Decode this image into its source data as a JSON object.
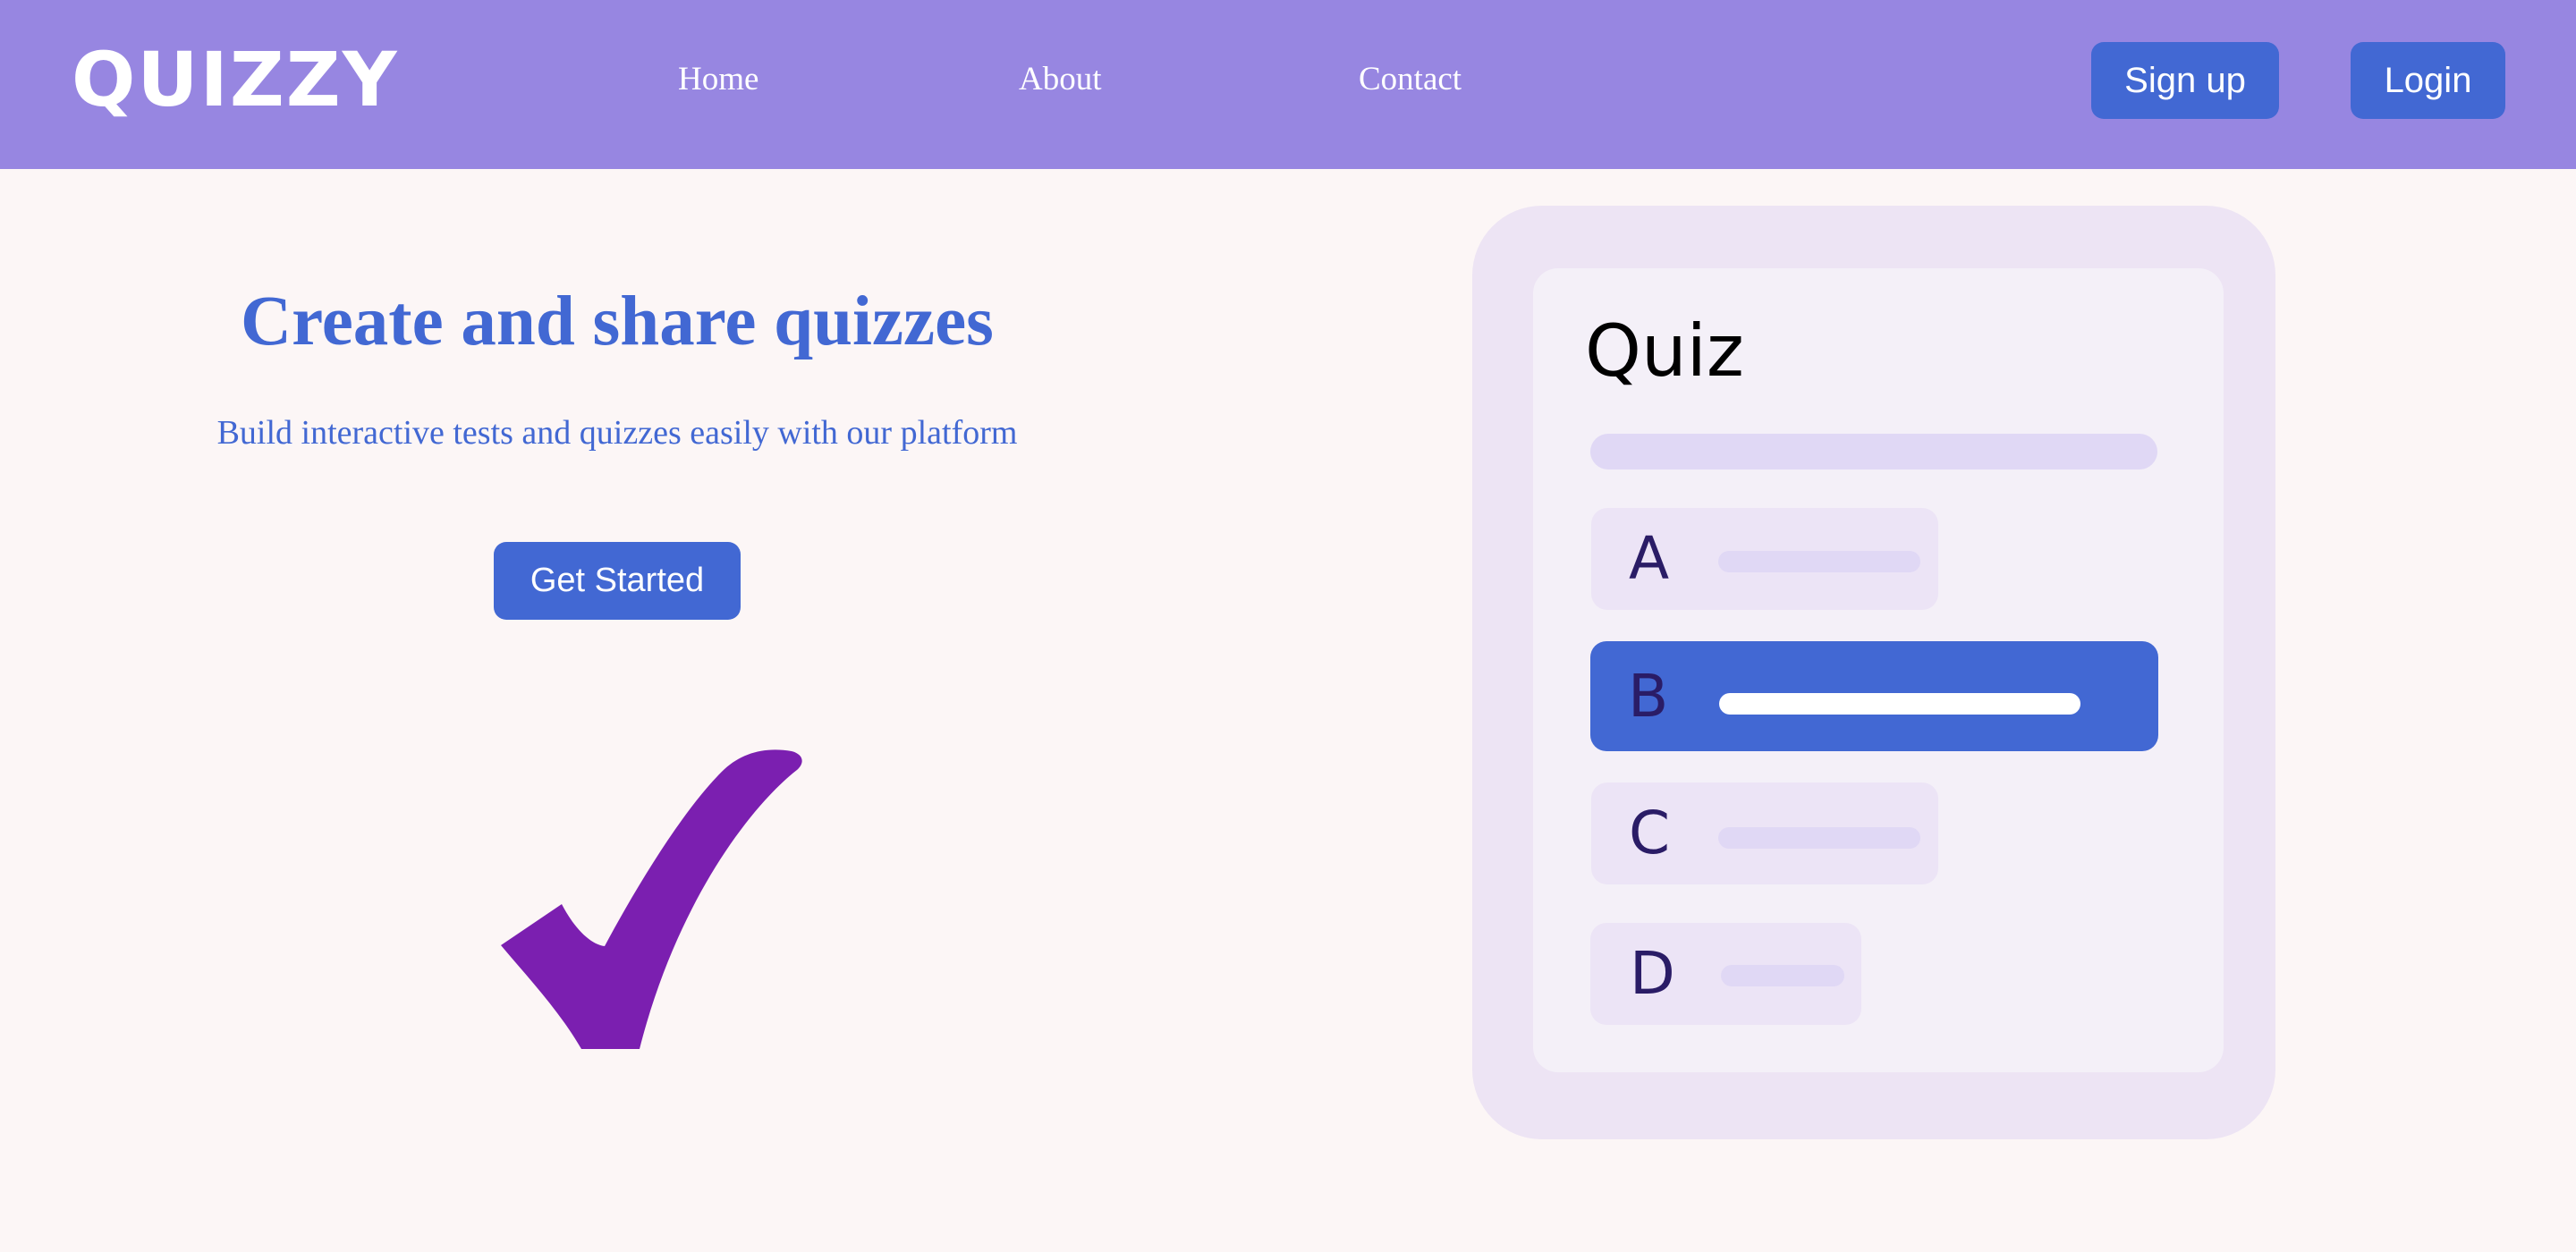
{
  "header": {
    "logo": "QUIZZY",
    "nav": [
      {
        "label": "Home"
      },
      {
        "label": "About"
      },
      {
        "label": "Contact"
      }
    ],
    "signup_label": "Sign up",
    "login_label": "Login"
  },
  "hero": {
    "title": "Create and share quizzes",
    "subtitle": "Build interactive tests and quizzes easily with our platform",
    "cta_label": "Get Started"
  },
  "quiz_card": {
    "title": "Quiz",
    "options": [
      {
        "letter": "A",
        "selected": false
      },
      {
        "letter": "B",
        "selected": true
      },
      {
        "letter": "C",
        "selected": false
      },
      {
        "letter": "D",
        "selected": false
      }
    ]
  },
  "colors": {
    "header_bg": "#9786e1",
    "page_bg": "#fcf6f6",
    "accent": "#4268d3",
    "checkmark": "#7b1fb0",
    "card_outer": "#ede4f4",
    "card_inner": "#f4f0f8",
    "option_bg": "#ece4f6",
    "placeholder_line": "#e0d8f5",
    "option_letter": "#2a1c66"
  },
  "icons": {
    "hero_graphic": "checkmark-icon"
  }
}
